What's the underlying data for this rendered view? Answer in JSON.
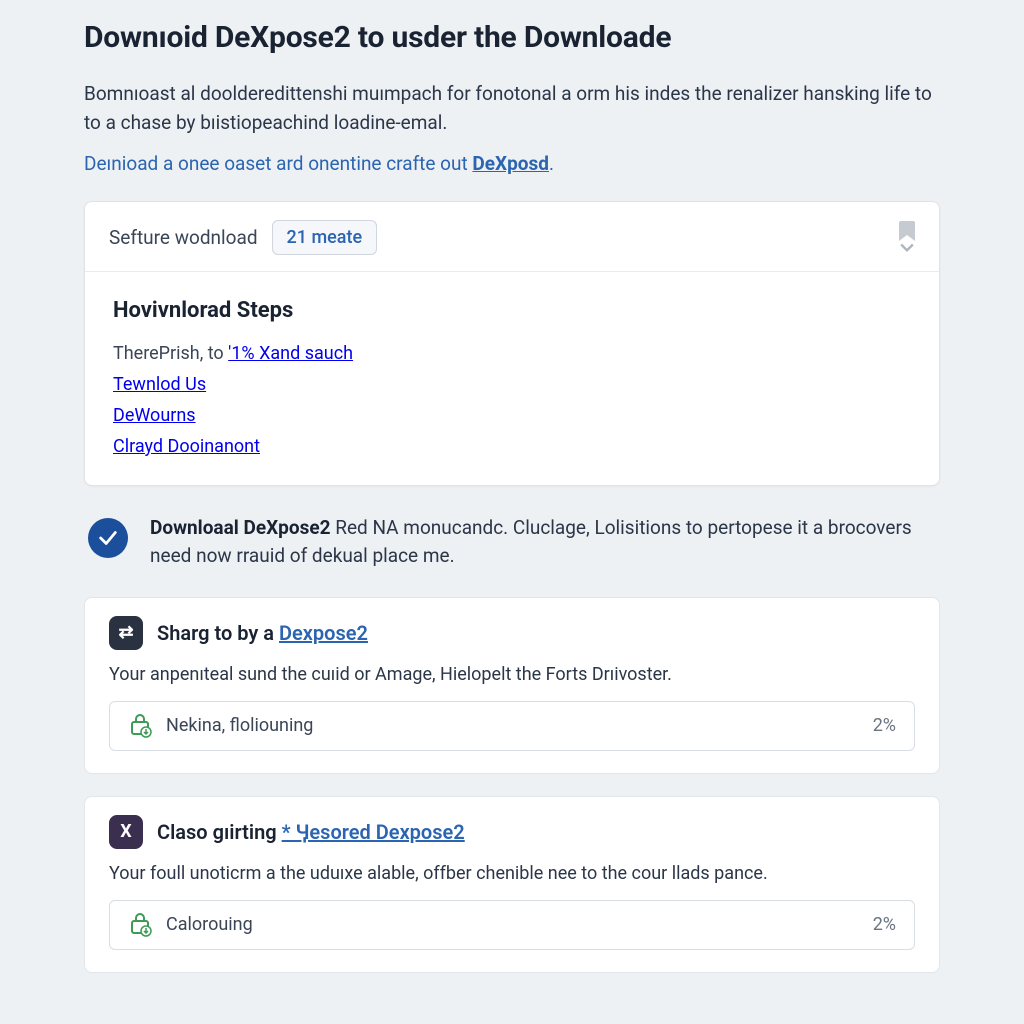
{
  "header": {
    "title": "Downıoid DeXpose2 to usder the Downloade",
    "intro": "Bomnıoast al doolderedittenshi muımpach for fonotonal a orm his indes the renalizer hansking life to to a chase by bıistiopeachind loadine-emal.",
    "link_line_prefix": "Deınioad a onee oaset ard onentine crafte out ",
    "link_line_strong": "DeXposd",
    "link_line_suffix": "."
  },
  "panel": {
    "header_label": "Sefture wodnload",
    "badge_text": "21 meate",
    "steps_title": "Hovivnlorad Steps",
    "steps": [
      {
        "prefix": "TherePrish, to ",
        "link": "'1% Xand sauch"
      },
      {
        "prefix": "",
        "link": "Tewnlod Us"
      },
      {
        "prefix": "",
        "link": "DeWourns"
      },
      {
        "prefix": "",
        "link": "Clrayd Doоinanont"
      }
    ]
  },
  "callout": {
    "strong": "Downloaal DeXpose2",
    "rest": " Red NA monucandc. Cluclage, Lolisitions to pertopese it a brocovers need now rrauid of dekual place me."
  },
  "cards": [
    {
      "icon_bg": "dark",
      "icon_glyph": "⇄",
      "title_prefix": "Sharg to by a ",
      "title_link": "Dexpose2",
      "title_suffix": "",
      "desc": "Your anpenıteal sund the cuıid or Amage, Hielopelt the Forts Drıivoster.",
      "progress_label": "Nekina, floliouning",
      "progress_pct": "2%"
    },
    {
      "icon_bg": "purple",
      "icon_glyph": "X",
      "title_prefix": "Claso gıirting ",
      "title_link": "* Ӌesored Dexpose2",
      "title_suffix": "",
      "desc": "Your foull unoticrm a the uduıxe alable, offber chenible nee to the cour llads pance.",
      "progress_label": "Calorouing",
      "progress_pct": "2%"
    }
  ]
}
